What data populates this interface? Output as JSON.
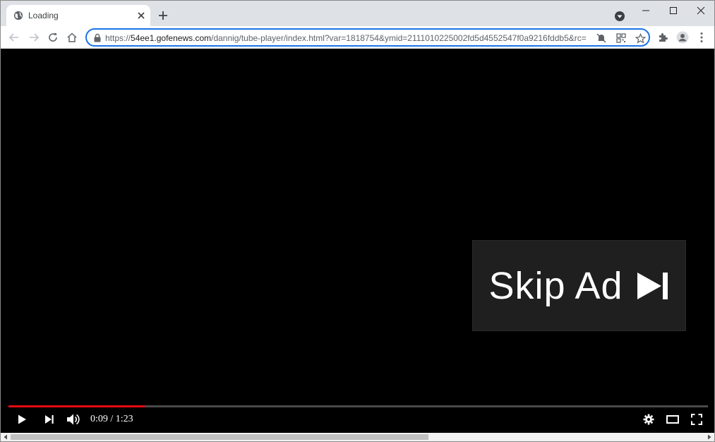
{
  "tab": {
    "title": "Loading"
  },
  "address_bar": {
    "url_scheme": "https://",
    "url_host": "54ee1.gofenews.com",
    "url_rest": "/dannig/tube-player/index.html?var=1818754&ymid=2111010225002fd5d4552547f0a9216fddb5&rc="
  },
  "player": {
    "skip_ad_label": "Skip Ad",
    "time_display": "0:09 / 1:23",
    "progress_fraction": 0.195
  },
  "colors": {
    "accent": "#1a73e8",
    "progress": "#e50914",
    "video_bg": "#000000",
    "skip_bg": "#1f1f1f"
  },
  "icons": {
    "favicon": "globe-icon",
    "skip": "skip-next-icon"
  }
}
